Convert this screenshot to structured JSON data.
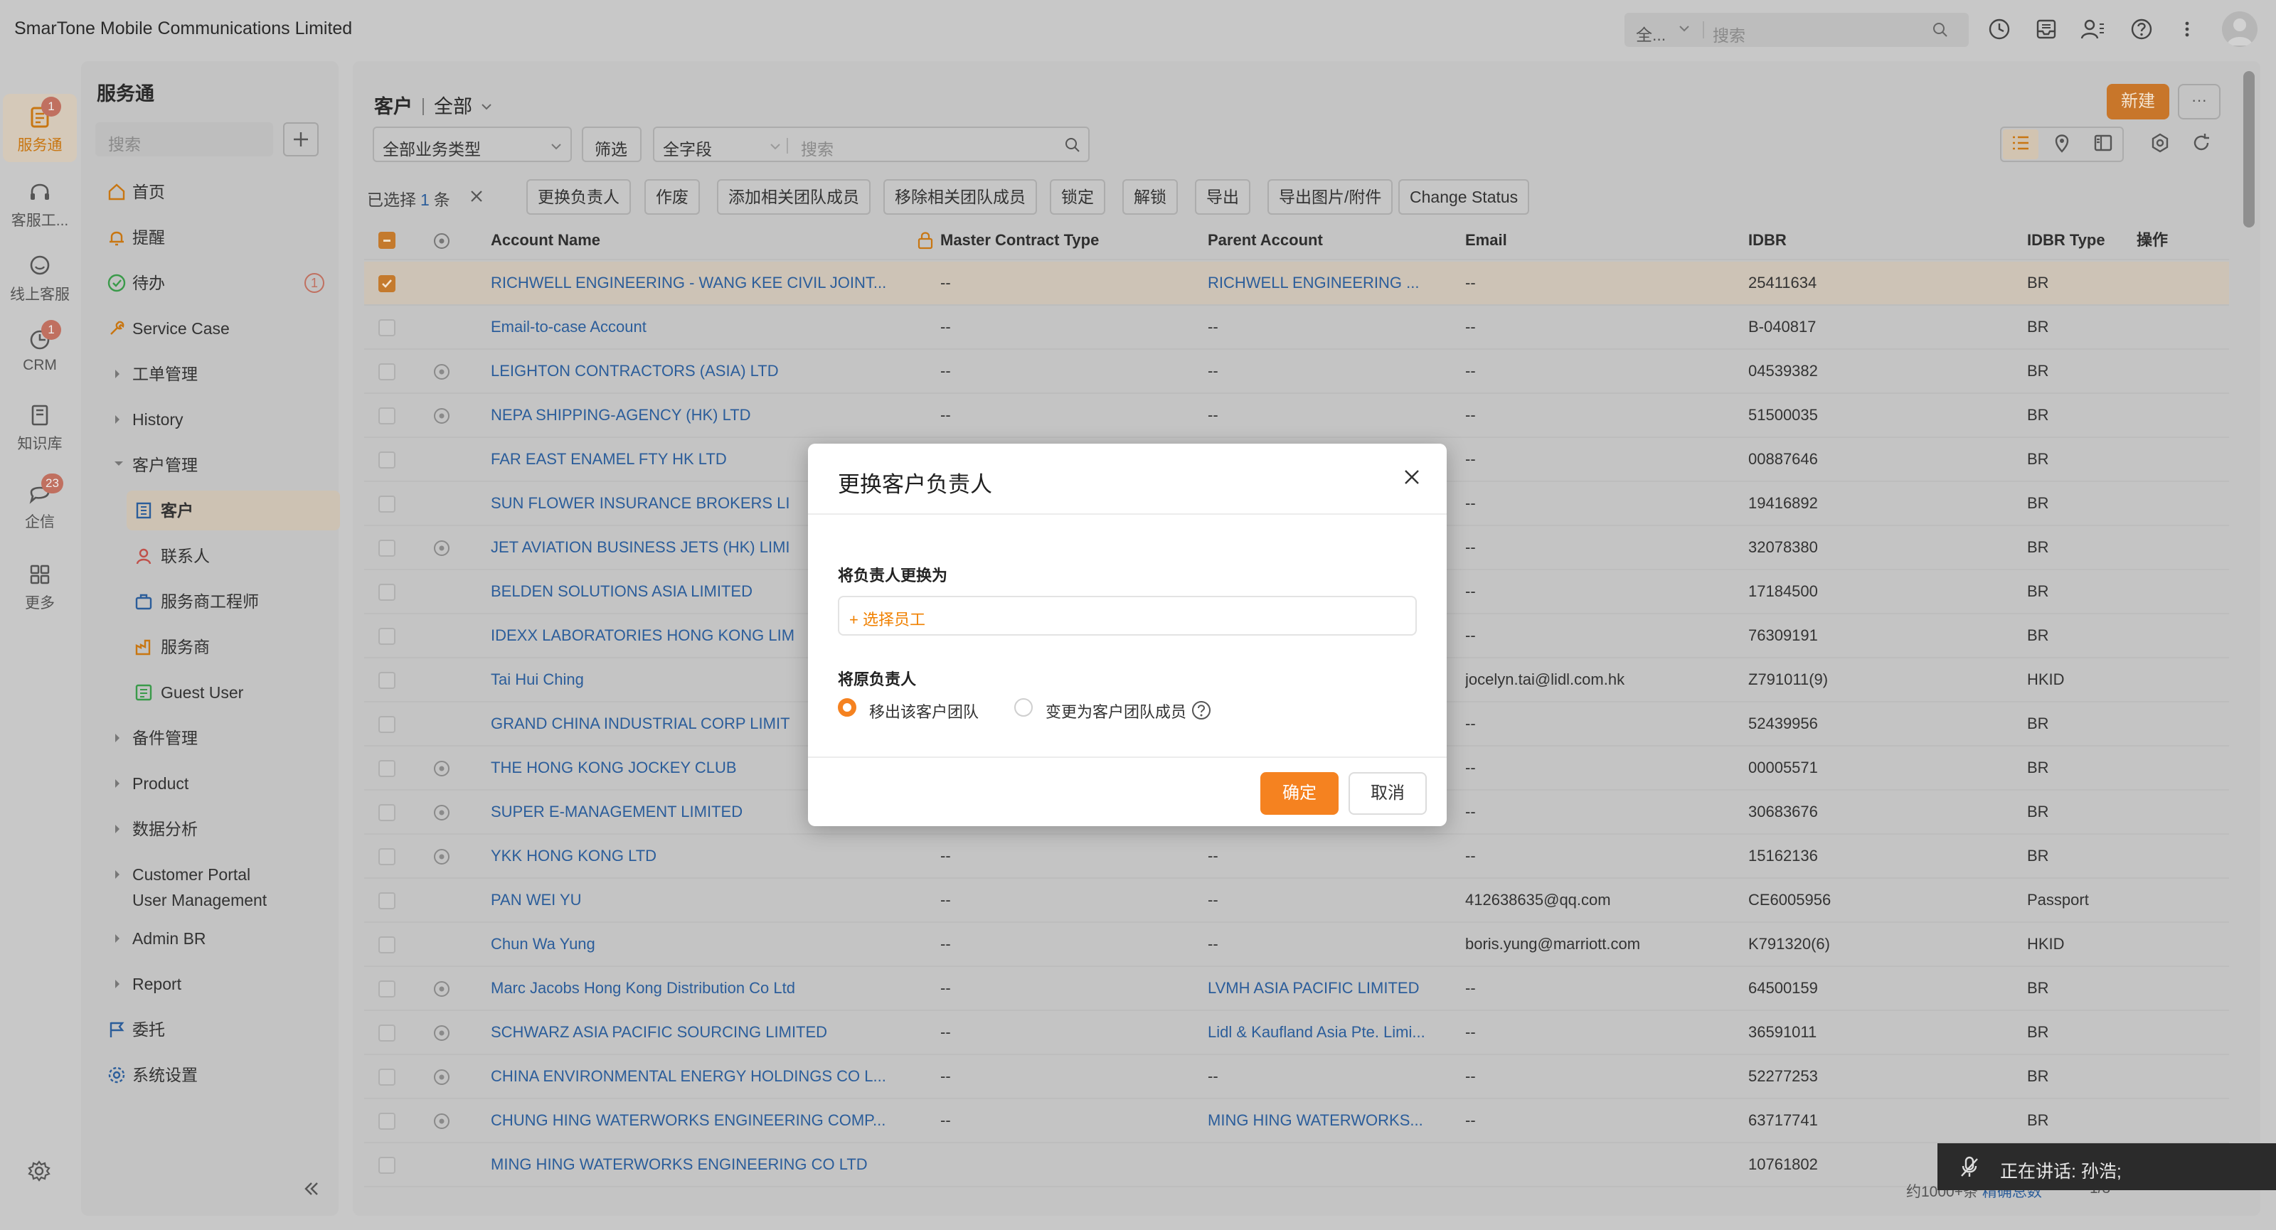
{
  "app": {
    "company": "SmarTone Mobile Communications Limited"
  },
  "global_search": {
    "scope": "全...",
    "placeholder": "搜索"
  },
  "rail": [
    {
      "label": "服务通",
      "icon": "service-icon",
      "badge": "1"
    },
    {
      "label": "客服工...",
      "icon": "headset-icon"
    },
    {
      "label": "线上客服",
      "icon": "chat-icon"
    },
    {
      "label": "CRM",
      "icon": "crm-icon",
      "badge": "1"
    },
    {
      "label": "知识库",
      "icon": "book-icon"
    },
    {
      "label": "企信",
      "icon": "message-icon",
      "badge": "23"
    },
    {
      "label": "更多",
      "icon": "grid-icon"
    }
  ],
  "nav": {
    "title": "服务通",
    "search_placeholder": "搜索",
    "items": [
      {
        "label": "首页"
      },
      {
        "label": "提醒"
      },
      {
        "label": "待办",
        "badge": "1"
      },
      {
        "label": "Service Case"
      },
      {
        "label": "工单管理"
      },
      {
        "label": "History"
      },
      {
        "label": "客户管理"
      },
      {
        "label": "客户"
      },
      {
        "label": "联系人"
      },
      {
        "label": "服务商工程师"
      },
      {
        "label": "服务商"
      },
      {
        "label": "Guest User"
      },
      {
        "label": "备件管理"
      },
      {
        "label": "Product"
      },
      {
        "label": "数据分析"
      },
      {
        "label": "Customer Portal"
      },
      {
        "label": "User Management"
      },
      {
        "label": "Admin BR"
      },
      {
        "label": "Report"
      },
      {
        "label": "委托"
      },
      {
        "label": "系统设置"
      }
    ]
  },
  "main": {
    "breadcrumb": {
      "object": "客户",
      "view": "全部"
    },
    "new_label": "新建",
    "more_label": "···",
    "filters": {
      "biz_type": "全部业务类型",
      "filter_label": "筛选",
      "field": "全字段",
      "search_placeholder": "搜索"
    },
    "selection": {
      "prefix": "已选择",
      "count": "1",
      "suffix": "条"
    },
    "actions": [
      "更换负责人",
      "作废",
      "添加相关团队成员",
      "移除相关团队成员",
      "锁定",
      "解锁",
      "导出",
      "导出图片/附件",
      "Change Status"
    ],
    "columns": [
      "Account Name",
      "Master Contract Type",
      "Parent Account",
      "Email",
      "IDBR",
      "IDBR Type",
      "操作"
    ],
    "rows": [
      {
        "name": "RICHWELL ENGINEERING - WANG KEE CIVIL JOINT...",
        "mct": "--",
        "parent": "RICHWELL ENGINEERING ...",
        "email": "--",
        "idbr": "25411634",
        "type": "BR"
      },
      {
        "name": "Email-to-case Account",
        "mct": "--",
        "parent": "--",
        "email": "--",
        "idbr": "B-040817",
        "type": "BR"
      },
      {
        "name": "LEIGHTON CONTRACTORS (ASIA) LTD",
        "mct": "--",
        "parent": "--",
        "email": "--",
        "idbr": "04539382",
        "type": "BR"
      },
      {
        "name": "NEPA SHIPPING-AGENCY (HK) LTD",
        "mct": "--",
        "parent": "--",
        "email": "--",
        "idbr": "51500035",
        "type": "BR"
      },
      {
        "name": "FAR EAST ENAMEL FTY HK LTD",
        "mct": "",
        "parent": "",
        "email": "--",
        "idbr": "00887646",
        "type": "BR"
      },
      {
        "name": "SUN FLOWER INSURANCE BROKERS LI",
        "mct": "",
        "parent": "",
        "email": "--",
        "idbr": "19416892",
        "type": "BR"
      },
      {
        "name": "JET AVIATION BUSINESS JETS (HK) LIMI",
        "mct": "",
        "parent": "",
        "email": "--",
        "idbr": "32078380",
        "type": "BR"
      },
      {
        "name": "BELDEN SOLUTIONS ASIA LIMITED",
        "mct": "",
        "parent": "",
        "email": "--",
        "idbr": "17184500",
        "type": "BR"
      },
      {
        "name": "IDEXX LABORATORIES HONG KONG LIM",
        "mct": "",
        "parent": "",
        "email": "--",
        "idbr": "76309191",
        "type": "BR"
      },
      {
        "name": "Tai Hui Ching",
        "mct": "",
        "parent": "",
        "email": "jocelyn.tai@lidl.com.hk",
        "idbr": "Z791011(9)",
        "type": "HKID"
      },
      {
        "name": "GRAND CHINA INDUSTRIAL CORP LIMIT",
        "mct": "",
        "parent": "",
        "email": "--",
        "idbr": "52439956",
        "type": "BR"
      },
      {
        "name": "THE HONG KONG JOCKEY CLUB",
        "mct": "",
        "parent": "",
        "email": "--",
        "idbr": "00005571",
        "type": "BR"
      },
      {
        "name": "SUPER E-MANAGEMENT LIMITED",
        "mct": "",
        "parent": "",
        "email": "--",
        "idbr": "30683676",
        "type": "BR"
      },
      {
        "name": "YKK HONG KONG LTD",
        "mct": "--",
        "parent": "--",
        "email": "--",
        "idbr": "15162136",
        "type": "BR"
      },
      {
        "name": "PAN WEI YU",
        "mct": "--",
        "parent": "--",
        "email": "412638635@qq.com",
        "idbr": "CE6005956",
        "type": "Passport"
      },
      {
        "name": "Chun Wa Yung",
        "mct": "--",
        "parent": "--",
        "email": "boris.yung@marriott.com",
        "idbr": "K791320(6)",
        "type": "HKID"
      },
      {
        "name": "Marc Jacobs Hong Kong Distribution Co Ltd",
        "mct": "--",
        "parent": "LVMH ASIA PACIFIC LIMITED",
        "email": "--",
        "idbr": "64500159",
        "type": "BR"
      },
      {
        "name": "SCHWARZ ASIA PACIFIC SOURCING LIMITED",
        "mct": "--",
        "parent": "Lidl & Kaufland Asia Pte. Limi...",
        "email": "--",
        "idbr": "36591011",
        "type": "BR"
      },
      {
        "name": "CHINA ENVIRONMENTAL ENERGY HOLDINGS CO L...",
        "mct": "--",
        "parent": "--",
        "email": "--",
        "idbr": "52277253",
        "type": "BR"
      },
      {
        "name": "CHUNG HING WATERWORKS ENGINEERING COMP...",
        "mct": "--",
        "parent": "MING HING WATERWORKS...",
        "email": "--",
        "idbr": "63717741",
        "type": "BR"
      },
      {
        "name": "MING HING WATERWORKS ENGINEERING CO LTD",
        "mct": "",
        "parent": "",
        "email": "",
        "idbr": "10761802",
        "type": ""
      }
    ],
    "footer": {
      "total": "约1000+条",
      "link": "精确总数",
      "page": "1/3"
    }
  },
  "modal": {
    "title": "更换客户负责人",
    "new_owner_label": "将负责人更换为",
    "select_employee": "+ 选择员工",
    "old_owner_label": "将原负责人",
    "option_remove": "移出该客户团队",
    "option_member": "变更为客户团队成员",
    "ok": "确定",
    "cancel": "取消"
  },
  "speaker": {
    "text": "正在讲话:  孙浩;"
  },
  "colors": {
    "accent": "#f58220",
    "link": "#2b5d9a"
  }
}
